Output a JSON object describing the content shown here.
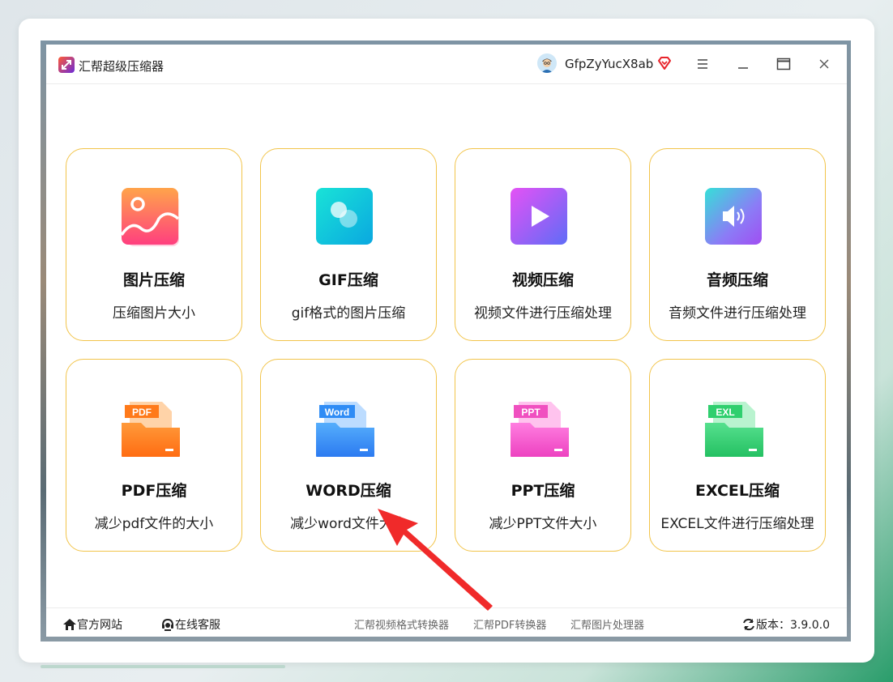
{
  "window": {
    "title": "汇帮超级压缩器",
    "username": "GfpZyYucX8ab"
  },
  "cards": [
    {
      "title": "图片压缩",
      "desc": "压缩图片大小",
      "icon": "image-icon"
    },
    {
      "title": "GIF压缩",
      "desc": "gif格式的图片压缩",
      "icon": "gif-icon"
    },
    {
      "title": "视频压缩",
      "desc": "视频文件进行压缩处理",
      "icon": "video-icon"
    },
    {
      "title": "音频压缩",
      "desc": "音频文件进行压缩处理",
      "icon": "audio-icon"
    },
    {
      "title": "PDF压缩",
      "desc": "减少pdf文件的大小",
      "icon": "pdf-folder-icon",
      "badge": "PDF"
    },
    {
      "title": "WORD压缩",
      "desc": "减少word文件大小",
      "icon": "word-folder-icon",
      "badge": "Word"
    },
    {
      "title": "PPT压缩",
      "desc": "减少PPT文件大小",
      "icon": "ppt-folder-icon",
      "badge": "PPT"
    },
    {
      "title": "EXCEL压缩",
      "desc": "EXCEL文件进行压缩处理",
      "icon": "excel-folder-icon",
      "badge": "EXL"
    }
  ],
  "footer": {
    "official_site": "官方网站",
    "online_service": "在线客服",
    "links": [
      "汇帮视频格式转换器",
      "汇帮PDF转换器",
      "汇帮图片处理器"
    ],
    "version": "版本：3.9.0.0"
  },
  "colors": {
    "card_border": "#f2c44a",
    "pdf": "#ff7a1a",
    "word": "#2f8cf5",
    "ppt": "#f050c0",
    "excel": "#2fcf6e",
    "arrow": "#f02a2a"
  }
}
